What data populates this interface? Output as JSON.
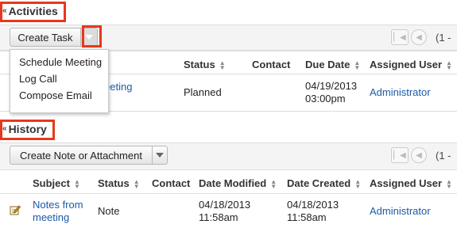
{
  "activities": {
    "title": "Activities",
    "create_button": "Create Task",
    "pager_text": "(1 -",
    "menu_items": [
      "Schedule Meeting",
      "Log Call",
      "Compose Email"
    ],
    "columns": [
      "Status",
      "Contact",
      "Due Date",
      "Assigned User"
    ],
    "row": {
      "subject_partial": "eeting",
      "status": "Planned",
      "due_date": "04/19/2013",
      "due_time": "03:00pm",
      "assigned_user": "Administrator"
    }
  },
  "history": {
    "title": "History",
    "create_button": "Create Note or Attachment",
    "pager_text": "(1 -",
    "columns": [
      "Subject",
      "Status",
      "Contact",
      "Date Modified",
      "Date Created",
      "Assigned User"
    ],
    "row": {
      "subject_line1": "Notes from",
      "subject_line2": "meeting",
      "status": "Note",
      "modified_date": "04/18/2013",
      "modified_time": "11:58am",
      "created_date": "04/18/2013",
      "created_time": "11:58am",
      "assigned_user": "Administrator"
    }
  },
  "colors": {
    "highlight": "#e8371c",
    "link": "#1a5aa8"
  }
}
